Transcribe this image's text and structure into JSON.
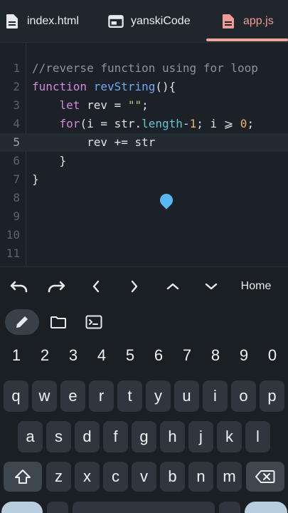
{
  "tabs": [
    {
      "label": "index.html",
      "icon": "file-icon"
    },
    {
      "label": "yanskiCode",
      "icon": "browser-window-icon"
    },
    {
      "label": "app.js",
      "icon": "file-icon",
      "active": true
    }
  ],
  "editor": {
    "line_numbers": [
      "1",
      "2",
      "3",
      "4",
      "5",
      "6",
      "7",
      "8",
      "9",
      "10",
      "11"
    ],
    "active_line": 5,
    "lines": [
      [
        {
          "t": "//reverse function using for loop",
          "c": "comment"
        }
      ],
      [
        {
          "t": "function ",
          "c": "kw"
        },
        {
          "t": "revString",
          "c": "fn"
        },
        {
          "t": "(){",
          "c": "plain"
        }
      ],
      [
        {
          "t": "    ",
          "c": "plain"
        },
        {
          "t": "let",
          "c": "kw"
        },
        {
          "t": " rev = ",
          "c": "plain"
        },
        {
          "t": "\"\"",
          "c": "str"
        },
        {
          "t": ";",
          "c": "plain"
        }
      ],
      [
        {
          "t": "    ",
          "c": "plain"
        },
        {
          "t": "for",
          "c": "kw"
        },
        {
          "t": "(i = str.",
          "c": "plain"
        },
        {
          "t": "length",
          "c": "prop"
        },
        {
          "t": "-",
          "c": "plain"
        },
        {
          "t": "1",
          "c": "num"
        },
        {
          "t": "; i ⩾ ",
          "c": "plain"
        },
        {
          "t": "0",
          "c": "num"
        },
        {
          "t": ";",
          "c": "plain"
        }
      ],
      [
        {
          "t": "        rev += str",
          "c": "plain"
        }
      ],
      [
        {
          "t": "    }",
          "c": "plain"
        }
      ],
      [
        {
          "t": "}",
          "c": "plain"
        }
      ],
      [],
      [],
      [],
      []
    ]
  },
  "nav": {
    "home_label": "Home",
    "buttons": [
      "undo-icon",
      "redo-icon",
      "arrow-left-icon",
      "arrow-right-icon",
      "arrow-up-icon",
      "arrow-down-icon"
    ]
  },
  "keyboard": {
    "numbers": [
      "1",
      "2",
      "3",
      "4",
      "5",
      "6",
      "7",
      "8",
      "9",
      "0"
    ],
    "row1": [
      "q",
      "w",
      "e",
      "r",
      "t",
      "y",
      "u",
      "i",
      "o",
      "p"
    ],
    "row2": [
      "a",
      "s",
      "d",
      "f",
      "g",
      "h",
      "j",
      "k",
      "l"
    ],
    "row3": [
      "z",
      "x",
      "c",
      "v",
      "b",
      "n",
      "m"
    ]
  },
  "colors": {
    "accent_tab": "#f0a49d",
    "keyword": "#d586e0",
    "function": "#71a9f7",
    "string": "#a7d37c",
    "number": "#efb06d",
    "comment": "#8c949b",
    "caret": "#58b8f2"
  }
}
